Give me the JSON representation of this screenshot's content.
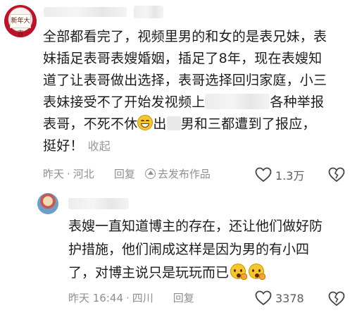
{
  "comment": {
    "lines": [
      "全部都看完了，视频里男的和女的是表兄妹，表",
      "妹插足表哥表嫂婚姻，插足了8年，现在表嫂知",
      "道了让表哥做出选择，表哥选择回归家庭，小三",
      "表妹接受不了开始发视频上",
      "各种举报",
      "表哥，不死不休",
      "出",
      "男和三都遭到了报应，",
      "挺好！"
    ],
    "collapse": "收起",
    "meta": {
      "time": "昨天",
      "location": "河北",
      "reply": "回复",
      "post_work": "去发布作品"
    },
    "likes": "1.3万",
    "avatar_text": "新年大吉",
    "icons": [
      "grin-emoji-icon",
      "heart-icon",
      "dislike-icon",
      "post-icon"
    ]
  },
  "reply": {
    "lines": [
      "表嫂一直知道博主的存在，还让他们做好防",
      "护措施，他们闹成这样是因为男的有小四",
      "了，对博主说只是玩玩而已"
    ],
    "meta": {
      "time": "昨天 16:44",
      "location": "四川",
      "reply": "回复"
    },
    "likes": "3378",
    "icons": [
      "thinking-emoji-icon",
      "thinking-emoji-icon",
      "heart-icon",
      "dislike-icon"
    ]
  },
  "colors": {
    "text": "#1c1c1c",
    "meta": "#8f8f8f",
    "blur": "#e9e9e9"
  }
}
